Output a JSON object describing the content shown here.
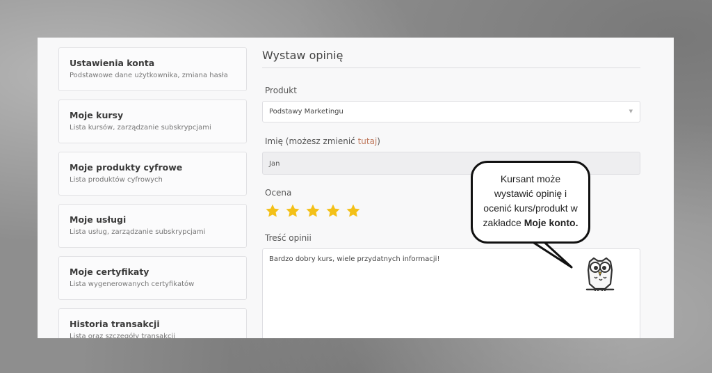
{
  "sidebar": {
    "items": [
      {
        "title": "Ustawienia konta",
        "desc": "Podstawowe dane użytkownika, zmiana hasła"
      },
      {
        "title": "Moje kursy",
        "desc": "Lista kursów, zarządzanie subskrypcjami"
      },
      {
        "title": "Moje produkty cyfrowe",
        "desc": "Lista produktów cyfrowych"
      },
      {
        "title": "Moje usługi",
        "desc": "Lista usług, zarządzanie subskrypcjami"
      },
      {
        "title": "Moje certyfikaty",
        "desc": "Lista wygenerowanych certyfikatów"
      },
      {
        "title": "Historia transakcji",
        "desc": "Lista oraz szczegóły transakcji"
      }
    ]
  },
  "form": {
    "heading": "Wystaw opinię",
    "product_label": "Produkt",
    "product_value": "Podstawy Marketingu",
    "name_label": "Imię (możesz zmienić ",
    "name_link": "tutaj",
    "name_label_end": ")",
    "name_value": "Jan",
    "rating_label": "Ocena",
    "rating_value": 5,
    "rating_max": 5,
    "content_label": "Treść opinii",
    "content_value": "Bardzo dobry kurs, wiele przydatnych informacji!"
  },
  "callout": {
    "line1": "Kursant może",
    "line2": "wystawić opinię i",
    "line3": "ocenić kurs/produkt w",
    "line4_prefix": "zakładce ",
    "line4_bold": "Moje konto."
  },
  "colors": {
    "star": "#f3c018",
    "link": "#c07a5e",
    "panel": "#f8f8f9"
  },
  "icons": {
    "caret": "chevron-down-icon",
    "star": "star-icon",
    "mascot": "owl-icon"
  }
}
